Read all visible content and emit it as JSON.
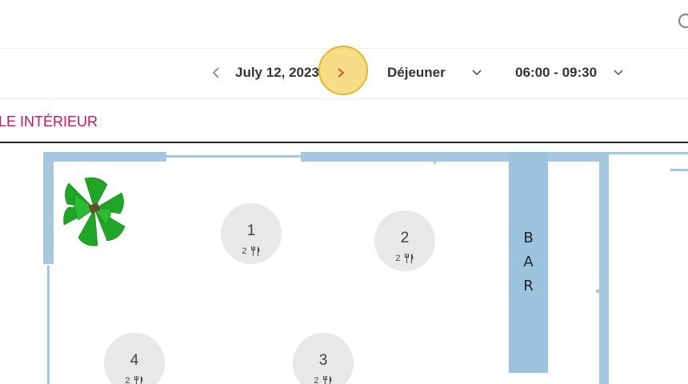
{
  "header": {
    "search_icon": "search-icon"
  },
  "date_nav": {
    "prev_icon": "chevron-left-icon",
    "date": "July 12, 2023",
    "next_icon": "chevron-right-icon",
    "service": "Déjeuner",
    "time_range": "06:00 - 09:30"
  },
  "room": {
    "tab_label": "LE INTÉRIEUR"
  },
  "floorplan": {
    "bar_letters": [
      "B",
      "A",
      "R"
    ],
    "tables": [
      {
        "number": "1",
        "capacity": "2"
      },
      {
        "number": "2",
        "capacity": "2"
      },
      {
        "number": "3",
        "capacity": "2"
      },
      {
        "number": "4",
        "capacity": "2"
      }
    ]
  },
  "colors": {
    "accent": "#c2185b",
    "wall": "#a5c8e0",
    "bar": "#9cc3de",
    "highlight": "#f5c83c",
    "next_arrow": "#e0502a"
  }
}
